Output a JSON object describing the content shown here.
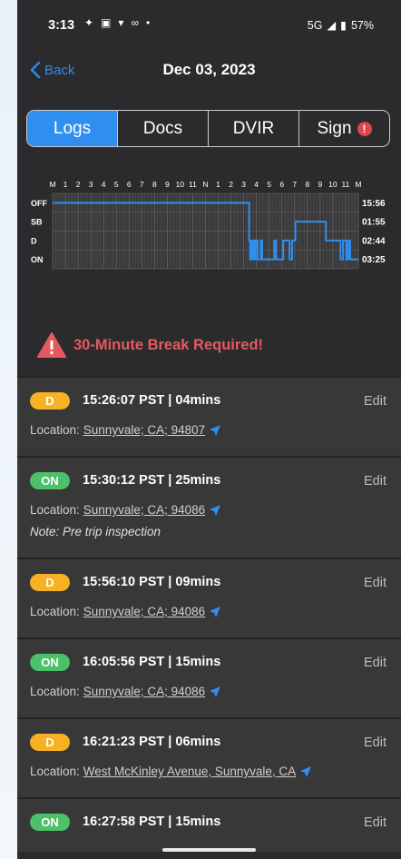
{
  "status": {
    "time": "3:13",
    "network": "5G",
    "battery": "57%"
  },
  "nav": {
    "back_label": "Back",
    "title": "Dec 03, 2023"
  },
  "tabs": [
    {
      "label": "Logs",
      "active": true
    },
    {
      "label": "Docs",
      "active": false
    },
    {
      "label": "DVIR",
      "active": false
    },
    {
      "label": "Sign",
      "active": false,
      "alert": "!"
    }
  ],
  "chart_data": {
    "type": "line",
    "hour_labels": [
      "M",
      "1",
      "2",
      "3",
      "4",
      "5",
      "6",
      "7",
      "8",
      "9",
      "10",
      "11",
      "N",
      "1",
      "2",
      "3",
      "4",
      "5",
      "6",
      "7",
      "8",
      "9",
      "10",
      "11",
      "M"
    ],
    "status_labels": [
      "OFF",
      "SB",
      "D",
      "ON"
    ],
    "totals": [
      "15:56",
      "01:55",
      "02:44",
      "03:25"
    ],
    "series": [
      {
        "x": 0,
        "status": "OFF"
      },
      {
        "x": 15.43,
        "status": "D"
      },
      {
        "x": 15.5,
        "status": "ON"
      },
      {
        "x": 15.6,
        "status": "D"
      },
      {
        "x": 15.65,
        "status": "ON"
      },
      {
        "x": 15.75,
        "status": "D"
      },
      {
        "x": 15.85,
        "status": "ON"
      },
      {
        "x": 15.93,
        "status": "D"
      },
      {
        "x": 16.1,
        "status": "ON"
      },
      {
        "x": 16.35,
        "status": "D"
      },
      {
        "x": 16.45,
        "status": "ON"
      },
      {
        "x": 17.4,
        "status": "D"
      },
      {
        "x": 17.55,
        "status": "ON"
      },
      {
        "x": 18.1,
        "status": "D"
      },
      {
        "x": 18.6,
        "status": "ON"
      },
      {
        "x": 18.8,
        "status": "D"
      },
      {
        "x": 19.05,
        "status": "SB"
      },
      {
        "x": 21.45,
        "status": "D"
      },
      {
        "x": 22.6,
        "status": "ON"
      },
      {
        "x": 22.8,
        "status": "D"
      },
      {
        "x": 23.05,
        "status": "ON"
      },
      {
        "x": 23.2,
        "status": "D"
      },
      {
        "x": 23.35,
        "status": "ON"
      },
      {
        "x": 24.0,
        "status": "ON"
      }
    ]
  },
  "warning": "30-Minute Break Required!",
  "entries": [
    {
      "status": "D",
      "time": "15:26:07 PST | 04mins",
      "location_label": "Location:",
      "location": "Sunnyvale; CA; 94807",
      "note": "",
      "edit": "Edit"
    },
    {
      "status": "ON",
      "time": "15:30:12 PST | 25mins",
      "location_label": "Location:",
      "location": "Sunnyvale; CA; 94086",
      "note": "Note: Pre trip inspection",
      "edit": "Edit"
    },
    {
      "status": "D",
      "time": "15:56:10 PST | 09mins",
      "location_label": "Location:",
      "location": "Sunnyvale; CA; 94086",
      "note": "",
      "edit": "Edit"
    },
    {
      "status": "ON",
      "time": "16:05:56 PST | 15mins",
      "location_label": "Location:",
      "location": "Sunnyvale; CA; 94086",
      "note": "",
      "edit": "Edit"
    },
    {
      "status": "D",
      "time": "16:21:23 PST | 06mins",
      "location_label": "Location:",
      "location": "West McKinley Avenue, Sunnyvale, CA",
      "note": "",
      "edit": "Edit"
    },
    {
      "status": "ON",
      "time": "16:27:58 PST | 15mins",
      "location_label": "",
      "location": "",
      "note": "",
      "edit": "Edit"
    }
  ],
  "colors": {
    "accent": "#2f8ff0",
    "driving": "#f6b224",
    "on_duty": "#4dc06a",
    "warning": "#e55a60"
  }
}
